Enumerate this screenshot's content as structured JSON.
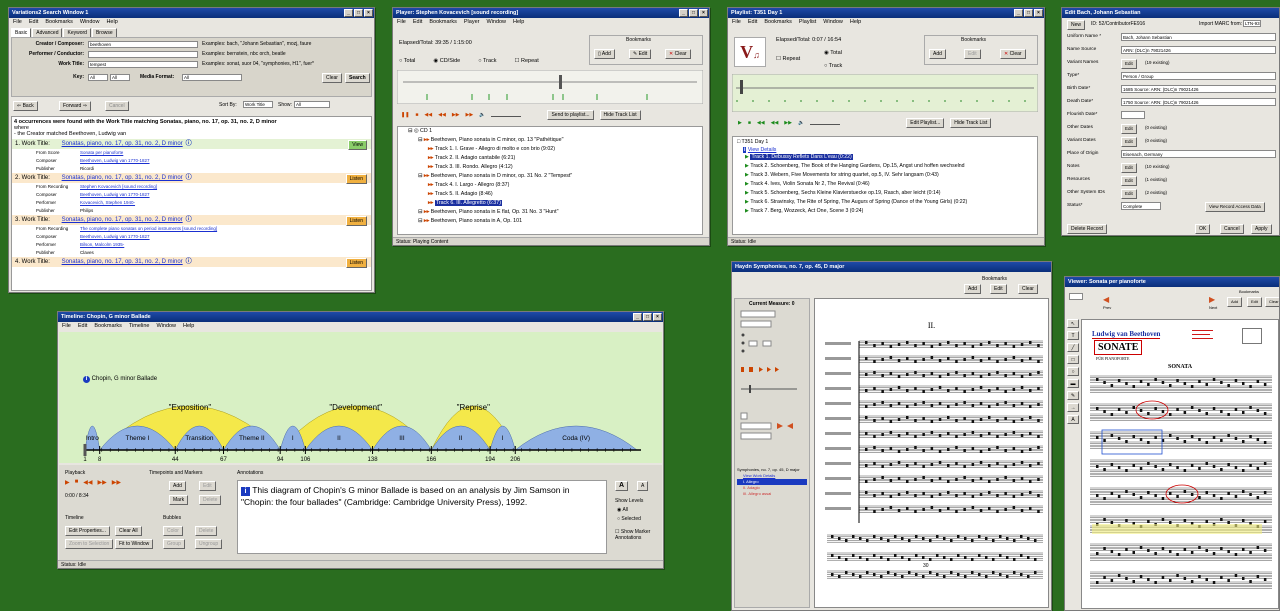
{
  "search": {
    "title": "Variations2 Search Window 1",
    "menus": [
      "File",
      "Edit",
      "Bookmarks",
      "Window",
      "Help"
    ],
    "tabs": [
      "Basic",
      "Advanced",
      "Keyword",
      "Browse"
    ],
    "creator_label": "Creator / Composer:",
    "creator_value": "beethoven",
    "creator_ex": "Examples: bach, \"Johann Sebastian\", mozj, faure",
    "performer_label": "Performer / Conductor:",
    "performer_ex": "Examples: bernstein, nbc orch, beatle",
    "work_label": "Work Title:",
    "work_value": "tempest",
    "work_ex": "Examples: sonat, suor 04, \"symphonies, H1\", fuer*",
    "key_label": "Key:",
    "key1": "All",
    "key2": "All",
    "media_label": "Media Format:",
    "media_value": "All",
    "clear": "Clear",
    "search_btn": "Search",
    "back": "Back",
    "forward": "Forward",
    "cancel": "Cancel",
    "sortby": "Sort By:",
    "sort_value": "Work Title",
    "show": "Show:",
    "show_value": "All",
    "summary1": "4 occurrences were found with the Work Title matching Sonatas, piano, no. 17, op. 31, no. 2, D minor",
    "summary2": "where",
    "summary3": "- the Creator matched Beethoven, Ludwig van",
    "results": [
      {
        "num": "1.",
        "label": "Work Title:",
        "title": "Sonatas, piano, no. 17, op. 31, no. 2, D minor",
        "action": "View",
        "details": [
          [
            "From Score",
            "Sonata per pianoforte"
          ],
          [
            "Composer",
            "Beethoven, Ludwig van 1770-1827"
          ],
          [
            "Publisher",
            "Ricordi"
          ]
        ]
      },
      {
        "num": "2.",
        "label": "Work Title:",
        "title": "Sonatas, piano, no. 17, op. 31, no. 2, D minor",
        "action": "Listen",
        "details": [
          [
            "From Recording",
            "Stephen Kovacevich [sound recording]"
          ],
          [
            "Composer",
            "Beethoven, Ludwig van 1770-1827"
          ],
          [
            "Performer",
            "Kovacevich, Stephen 1940-"
          ],
          [
            "Publisher",
            "Philips"
          ]
        ]
      },
      {
        "num": "3.",
        "label": "Work Title:",
        "title": "Sonatas, piano, no. 17, op. 31, no. 2, D minor",
        "action": "Listen",
        "details": [
          [
            "From Recording",
            "The complete piano sonatas on period instruments [sound recording]"
          ],
          [
            "Composer",
            "Beethoven, Ludwig van 1770-1827"
          ],
          [
            "Performer",
            "Bilson, Malcolm 1935-"
          ],
          [
            "Publisher",
            "Claves"
          ]
        ]
      },
      {
        "num": "4.",
        "label": "Work Title:",
        "title": "Sonatas, piano, no. 17, op. 31, no. 2, D minor",
        "action": "Listen",
        "details": []
      }
    ]
  },
  "player": {
    "title": "Player: Stephen Kovacevich [sound recording]",
    "menus": [
      "File",
      "Edit",
      "Bookmarks",
      "Player",
      "Window",
      "Help"
    ],
    "elapsed": "Elapsed/Total: 39:35 / 1:15:00",
    "bookmarks": "Bookmarks",
    "add": "Add",
    "edit": "Edit",
    "clear": "Clear",
    "modes": [
      "Total",
      "CD/Side",
      "Track"
    ],
    "repeat": "Repeat",
    "send": "Send to playlist...",
    "hide": "Hide Track List",
    "tree": [
      "CD 1",
      "Beethoven, Piano sonata in C minor, op. 13 \"Pathétique\"",
      "Track 1. I. Grave - Allegro di molto e con brio (9:02)",
      "Track 2. II. Adagio cantabile (6:21)",
      "Track 3. III. Rondo. Allegro (4:12)",
      "Beethoven, Piano sonata in D minor, op. 31 No. 2 \"Tempest\"",
      "Track 4. I. Largo - Allegro (8:37)",
      "Track 5. II. Adagio (8:46)",
      "Track 6. III. Allegretto (6:37)",
      "Beethoven, Piano sonata in E flat, Op. 31 No. 3 \"Hunt\"",
      "Beethoven, Piano sonata in A, Op. 101"
    ],
    "status": "Status: Playing Content"
  },
  "playlist": {
    "title": "Playlist: T351 Day 1",
    "menus": [
      "File",
      "Edit",
      "Bookmarks",
      "Playlist",
      "Window",
      "Help"
    ],
    "elapsed": "Elapsed/Total: 0:07 / 16:54",
    "bookmarks": "Bookmarks",
    "add": "Add",
    "edit": "Edit",
    "clear": "Clear",
    "repeat": "Repeat",
    "modes": [
      "Total",
      "Track"
    ],
    "edit_playlist": "Edit Playlist...",
    "hide": "Hide Track List",
    "root": "T351 Day 1",
    "view_details": "View Details",
    "tracks": [
      "Track 1. Debussy Reflets Dans L'eau (0:22)",
      "Track 2. Schoenberg, The Book of the Hanging Gardens, Op.15, Angst und hoffen wechselnd",
      "Track 3. Webern, Five Movements for string quartet, op.5, IV. Sehr langsam (0:43)",
      "Track 4. Ives, Violin Sonata Nr 2, The Revival (0:46)",
      "Track 5. Schoenberg, Sechs Kleine Klavierstuecke op.19, Rasch, aber leicht (0:14)",
      "Track 6. Stravinsky, The Rite of Spring, The Augurs of Spring (Dance of the Young Girls) (0:22)",
      "Track 7. Berg, Wozzeck, Act One, Scene 3 (0:24)"
    ],
    "status": "Status: Idle"
  },
  "edit": {
    "title": "Edit Bach, Johann Sebastian",
    "new": "New",
    "id": "ID: 52/ContributorFE916",
    "import": "Import MARC from:",
    "import_val": "LTN-93",
    "fields": [
      [
        "Uniform Name *",
        "Bach, Johann Sebastian"
      ],
      [
        "Name Source",
        "ARN: (DLC)n 79021426"
      ],
      [
        "Variant Names",
        "(19 existing)"
      ],
      [
        "Type*",
        "Person / Group"
      ],
      [
        "Birth Date*",
        "1685  Source: ARN: (DLC)n 79021426"
      ],
      [
        "Death Date*",
        "1750  Source: ARN: (DLC)n 79021426"
      ],
      [
        "Flourish Date*",
        ""
      ],
      [
        "Other Dates",
        "(0 existing)"
      ],
      [
        "Variant Dates",
        "(0 existing)"
      ],
      [
        "Place of Origin",
        "Eisenach, Germany"
      ],
      [
        "Notes",
        "(10 existing)"
      ],
      [
        "Resources",
        "(1 existing)"
      ],
      [
        "Other System IDs",
        "(2 existing)"
      ],
      [
        "Status*",
        "Complete"
      ]
    ],
    "edit_btn": "Edit",
    "view_access": "View Record Access Data",
    "delete": "Delete Record",
    "ok": "OK",
    "cancel": "Cancel",
    "apply": "Apply"
  },
  "timeline": {
    "title": "Timeline: Chopin, G minor Ballade",
    "menus": [
      "File",
      "Edit",
      "Bookmarks",
      "Timeline",
      "Window",
      "Help"
    ],
    "work": "Chopin, G minor Ballade",
    "upper": [
      {
        "label": "\"Exposition\"",
        "a": 8,
        "b": 94
      },
      {
        "label": "\"Development\"",
        "a": 94,
        "b": 166
      },
      {
        "label": "\"Reprise\"",
        "a": 166,
        "b": 206
      }
    ],
    "lower": [
      {
        "label": "Intro",
        "a": 1,
        "b": 8
      },
      {
        "label": "Theme I",
        "a": 8,
        "b": 44
      },
      {
        "label": "Transition",
        "a": 44,
        "b": 67
      },
      {
        "label": "Theme II",
        "a": 67,
        "b": 94
      },
      {
        "label": "I",
        "a": 94,
        "b": 106
      },
      {
        "label": "II",
        "a": 106,
        "b": 138
      },
      {
        "label": "III",
        "a": 138,
        "b": 166
      },
      {
        "label": "II",
        "a": 166,
        "b": 194
      },
      {
        "label": "I",
        "a": 194,
        "b": 206
      },
      {
        "label": "Coda (IV)",
        "a": 206,
        "b": 264
      }
    ],
    "ticks": [
      "1",
      "8",
      "44",
      "67",
      "94",
      "106",
      "138",
      "166",
      "194",
      "206"
    ],
    "playback": "Playback",
    "time": "0:00 / 8:34",
    "tempo": "Timepoints and Markers",
    "add": "Add",
    "edit": "Edit",
    "mark": "Mark",
    "delete": "Delete",
    "annotations": "Annotations",
    "annotation_text": "This diagram of Chopin's G minor Ballade is based on an analysis by Jim Samson in \"Chopin: the four ballades\" (Cambridge: Cambridge University Press), 1992.",
    "show_levels": "Show Levels",
    "levels": [
      "All",
      "Selected"
    ],
    "show_marker": "Show Marker Annotations",
    "timeline_label": "Timeline",
    "edit_props": "Edit Properties...",
    "clear_all": "Clear All",
    "zoom": "Zoom to Selection",
    "fit": "Fit to Window",
    "bubbles": "Bubbles",
    "color": "Color",
    "delete2": "Delete",
    "group": "Group",
    "ungroup": "Ungroup",
    "status": "Status: Idle"
  },
  "score": {
    "title": "Haydn Symphonies, no. 7, op. 45, D major",
    "bookmarks": "Bookmarks",
    "add": "Add",
    "edit": "Edit",
    "clear": "Clear",
    "current": "Current Measure: 0",
    "page_title": "II.",
    "tree_items": [
      "Symphonies, no. 7, op. 45, D major",
      "View Work Details",
      "I. Allegro",
      "II. Adagio",
      "III. Allegro assai"
    ],
    "page_num": "30"
  },
  "viewer": {
    "title": "Viewer: Sonata per pianoforte",
    "bookmarks": "Bookmarks",
    "add": "Add",
    "edit": "Edit",
    "clear": "Clear",
    "prev": "Prev",
    "next": "Next",
    "composer": "Ludwig van Beethoven",
    "sonate": "SONATE",
    "sub": "FÜR PIANOFORTE",
    "sonata": "SONATA"
  }
}
